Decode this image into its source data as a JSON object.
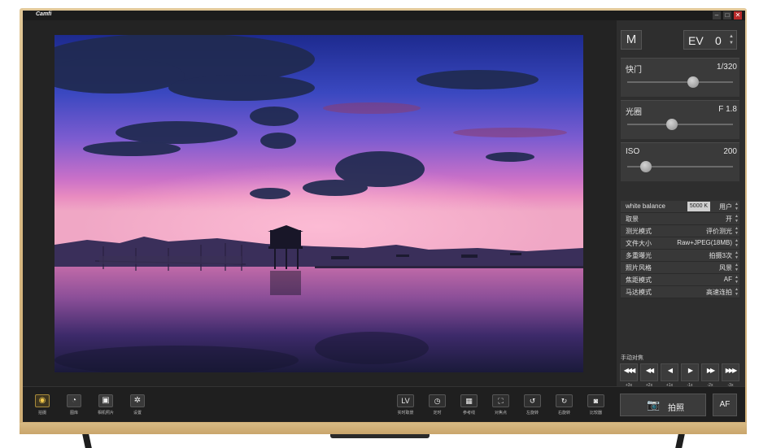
{
  "app": {
    "title": "Camfi"
  },
  "window": {
    "minimize": "–",
    "maximize": "□",
    "close": "✕"
  },
  "panel": {
    "mode_label": "M",
    "ev": {
      "label": "EV",
      "value": "0",
      "arrows": "▲\n▼"
    },
    "shutter": {
      "label": "快门",
      "value": "1/320",
      "level": 0.62
    },
    "aperture": {
      "label": "光圈",
      "value": "F 1.8",
      "level": 0.42
    },
    "iso": {
      "label": "ISO",
      "value": "200",
      "level": 0.18
    },
    "settings": [
      {
        "name": "white balance",
        "value": "5000 K",
        "extra": "用户"
      },
      {
        "name": "取景",
        "value": "开"
      },
      {
        "name": "测光模式",
        "value": "评价测光"
      },
      {
        "name": "文件大小",
        "value": "Raw+JPEG(18MB)"
      },
      {
        "name": "多重曝光",
        "value": "拍摄3次"
      },
      {
        "name": "照片风格",
        "value": "风景"
      },
      {
        "name": "焦距模式",
        "value": "AF"
      },
      {
        "name": "马达模式",
        "value": "高速连拍"
      }
    ],
    "manual_focus": {
      "label": "手动对焦",
      "buttons": [
        {
          "glyph": "◀◀◀",
          "sub": "+3x",
          "icon": "triple-left-icon"
        },
        {
          "glyph": "◀◀",
          "sub": "+2x",
          "icon": "double-left-icon"
        },
        {
          "glyph": "◀",
          "sub": "+1x",
          "icon": "left-icon"
        },
        {
          "glyph": "▶",
          "sub": "-1x",
          "icon": "right-icon"
        },
        {
          "glyph": "▶▶",
          "sub": "-2x",
          "icon": "double-right-icon"
        },
        {
          "glyph": "▶▶▶",
          "sub": "-3x",
          "icon": "triple-right-icon"
        }
      ]
    }
  },
  "bottom_bar": {
    "left_buttons": [
      {
        "glyph": "◉",
        "label": "拍摄",
        "icon": "camera-icon"
      },
      {
        "glyph": "◔",
        "label": "图库",
        "icon": "gallery-icon"
      },
      {
        "glyph": "▣",
        "label": "相机照片",
        "icon": "camera-photos-icon"
      },
      {
        "glyph": "✲",
        "label": "设置",
        "icon": "settings-icon"
      }
    ],
    "tools": [
      {
        "glyph": "LV",
        "label": "实时取景",
        "icon": "live-view-icon"
      },
      {
        "glyph": "◷",
        "label": "定时",
        "icon": "timer-icon"
      },
      {
        "glyph": "▦",
        "label": "参考线",
        "icon": "grid-icon"
      },
      {
        "glyph": "⛶",
        "label": "对焦点",
        "icon": "focus-point-icon"
      },
      {
        "glyph": "↺",
        "label": "左旋转",
        "icon": "rotate-left-icon"
      },
      {
        "glyph": "↻",
        "label": "右旋转",
        "icon": "rotate-right-icon"
      },
      {
        "glyph": "◙",
        "label": "比较器",
        "icon": "compare-icon"
      }
    ],
    "shoot": {
      "glyph": "📷",
      "label": "拍照"
    },
    "af_label": "AF"
  },
  "colors": {
    "active_accent": "#f2c84b",
    "panel_bg": "#2e2e2e",
    "frame_gold": "#d8b983"
  }
}
